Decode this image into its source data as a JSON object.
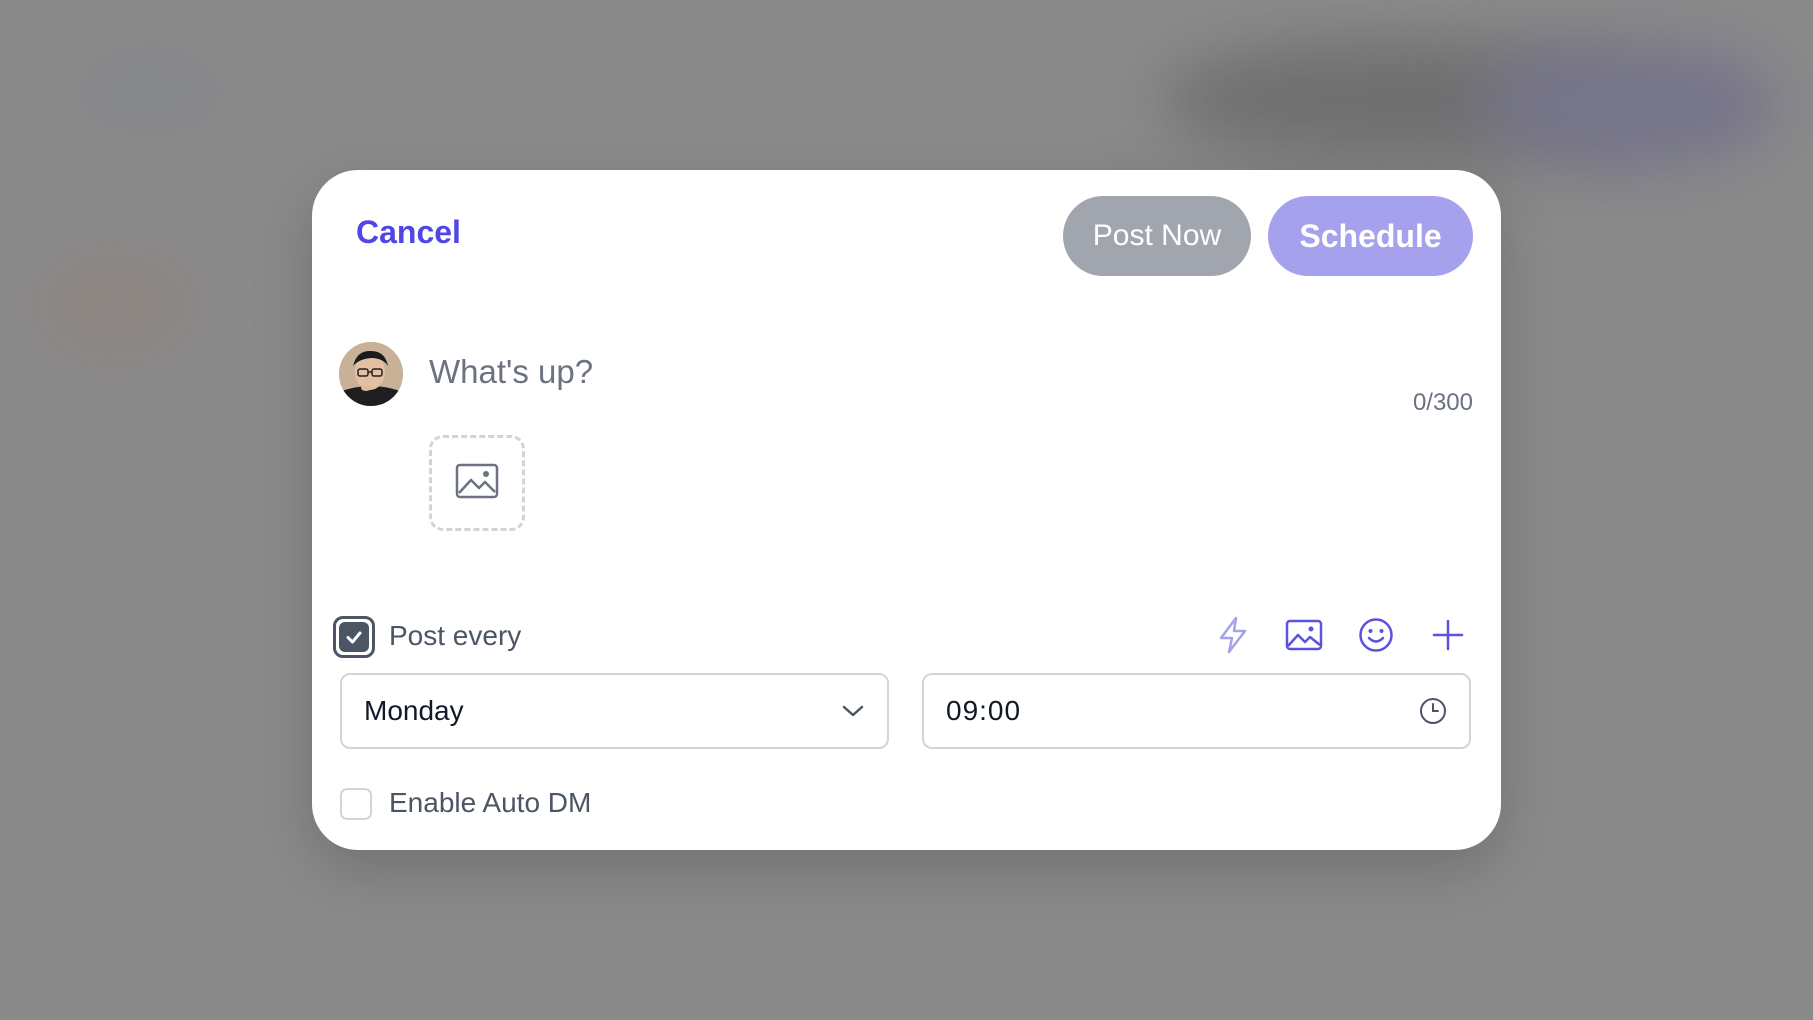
{
  "header": {
    "cancel_label": "Cancel",
    "post_now_label": "Post Now",
    "schedule_label": "Schedule"
  },
  "composer": {
    "placeholder": "What's up?",
    "char_count": "0/300"
  },
  "recurrence": {
    "checked": true,
    "label": "Post every",
    "day_value": "Monday",
    "time_value": "09:00"
  },
  "toolbar": {
    "icons": [
      "lightning-icon",
      "image-icon",
      "emoji-icon",
      "plus-icon"
    ]
  },
  "auto_dm": {
    "checked": false,
    "label": "Enable Auto DM"
  },
  "colors": {
    "accent": "#4f46e5",
    "schedule_bg": "#a6a1ec",
    "post_now_bg": "#a1a5ae",
    "icon_accent": "#5b52e0"
  }
}
